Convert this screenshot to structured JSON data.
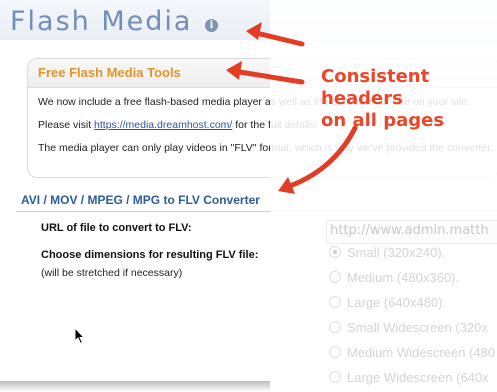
{
  "header": {
    "title": "Flash Media",
    "info_icon": "info-icon"
  },
  "tools": {
    "title": "Free Flash Media Tools",
    "line1": "We now include a free flash-based media player as well as the converter for use on your site.",
    "line2_prefix": "Please visit ",
    "link": "https://media.dreamhost.com/",
    "line2_suffix": " for the full details!",
    "line3": "The media player can only play videos in \"FLV\" format, which is why we've provided the converter."
  },
  "converter": {
    "title": "AVI / MOV / MPEG / MPG to FLV Converter",
    "url_label": "URL of file to convert to FLV:",
    "url_value": "http://www.admin.matth",
    "dims_label": "Choose dimensions for resulting FLV file:",
    "dims_note": "(will be stretched if necessary)",
    "options": [
      "Small (320x240).",
      "Medium (480x360).",
      "Large (640x480).",
      "Small Widescreen (320x",
      "Medium Widescreen (480",
      "Large Widescreen (640x"
    ],
    "selected_index": 0
  },
  "annotation": {
    "line1": "Consistent headers",
    "line2": "on all pages",
    "color": "#e8472b"
  }
}
